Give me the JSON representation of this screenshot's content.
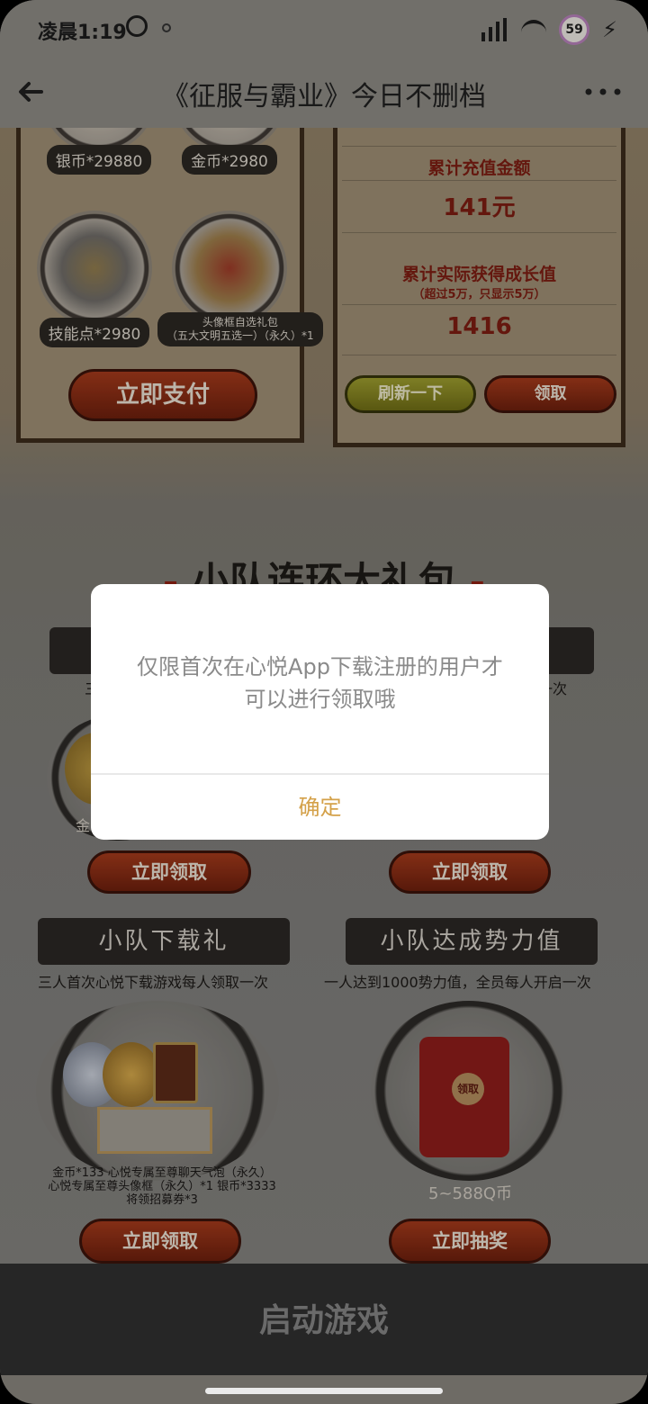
{
  "status_bar": {
    "time": "凌晨1:19",
    "battery": "59"
  },
  "header": {
    "title": "《征服与霸业》今日不删档"
  },
  "recharge": {
    "rewards": [
      {
        "label": "银币*29880"
      },
      {
        "label": "金币*2980"
      },
      {
        "label": "技能点*2980"
      },
      {
        "label": "头像框自选礼包",
        "sub": "（五大文明五选一）（永久）*1"
      }
    ],
    "pay_button": "立即支付",
    "total_label": "累计充值金额",
    "total_value": "141元",
    "growth_label": "累计实际获得成长值",
    "growth_note": "（超过5万，只显示5万）",
    "growth_value": "1416",
    "refresh_button": "刷新一下",
    "claim_button": "领取"
  },
  "team_section": {
    "title": "小队连环大礼包",
    "title_dash": "-",
    "partial_left_caption": "三",
    "partial_right_caption": "一次",
    "partial_left_label": "金",
    "claim_button_1": "立即领取",
    "claim_button_2": "立即领取",
    "download_gift": {
      "ribbon": "小队下载礼",
      "caption": "三人首次心悦下载游戏每人领取一次",
      "prize": "金币*133  心悦专属至尊聊天气泡（永久）\n心悦专属至尊头像框（永久）*1 银币*3333\n将领招募券*3",
      "button": "立即领取"
    },
    "power_gift": {
      "ribbon": "小队达成势力值",
      "caption": "一人达到1000势力值，全员每人开启一次",
      "envelope_seal": "领取",
      "prize": "5~588Q币",
      "button": "立即抽奖"
    }
  },
  "bottom_bar": {
    "launch_label": "启动游戏"
  },
  "dialog": {
    "message": "仅限首次在心悦App下载注册的用户才可以进行领取哦",
    "confirm": "确定"
  },
  "colors": {
    "confirm_text": "#d4a14a",
    "button_red": "#a1391b",
    "button_yellow": "#9a9a2e"
  }
}
